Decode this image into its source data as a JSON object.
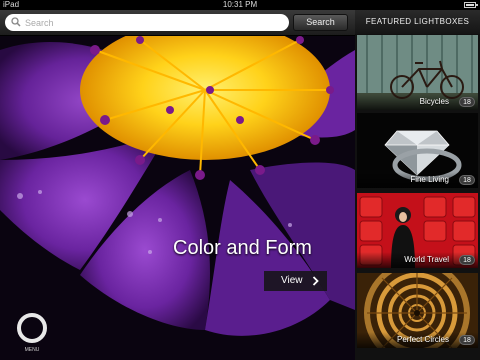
{
  "status_bar": {
    "carrier": "iPad",
    "time": "10:31 PM"
  },
  "search": {
    "placeholder": "Search",
    "value": "",
    "button_label": "Search"
  },
  "hero": {
    "title": "Color and Form",
    "view_label": "View"
  },
  "menu": {
    "label": "MENU"
  },
  "sidebar": {
    "title": "FEATURED LIGHTBOXES",
    "items": [
      {
        "label": "Bicycles",
        "count": "18"
      },
      {
        "label": "Fine Living",
        "count": "18"
      },
      {
        "label": "World Travel",
        "count": "18"
      },
      {
        "label": "Perfect Circles",
        "count": "18"
      }
    ]
  },
  "colors": {
    "petal": "#6a2a9a",
    "stamen": "#ffc000",
    "hero_bg": "#0a0410",
    "sidebar_bg": "#111111"
  }
}
